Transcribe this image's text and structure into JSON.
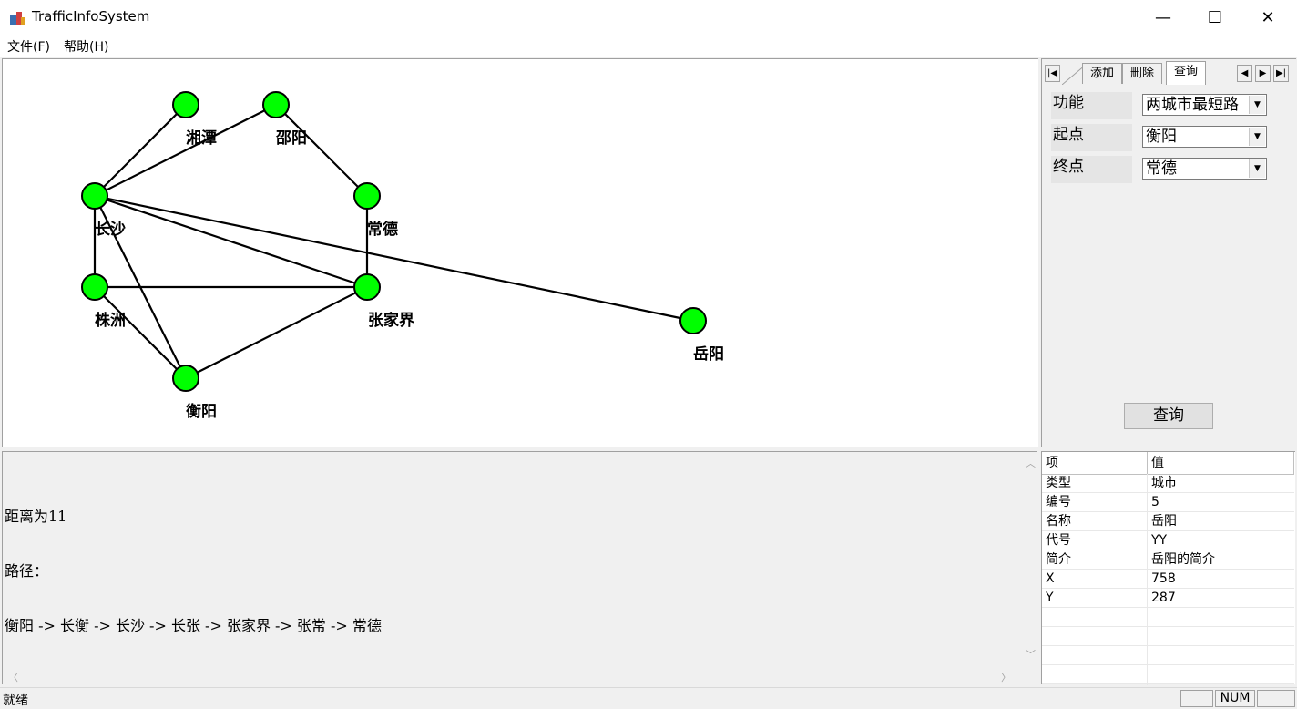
{
  "window": {
    "title": "TrafficInfoSystem",
    "minimize": "—",
    "maximize": "☐",
    "close": "✕"
  },
  "menu": {
    "items": [
      "文件(F)",
      "帮助(H)"
    ]
  },
  "tabs": [
    "添加",
    "删除",
    "查询"
  ],
  "query_form": {
    "function_label": "功能",
    "function_value": "两城市最短路",
    "start_label": "起点",
    "start_value": "衡阳",
    "end_label": "终点",
    "end_value": "常德",
    "button_label": "查询"
  },
  "graph": {
    "node_color": "#00ff00",
    "nodes": [
      {
        "name": "湘潭"
      },
      {
        "name": "邵阳"
      },
      {
        "name": "长沙"
      },
      {
        "name": "常德"
      },
      {
        "name": "株洲"
      },
      {
        "name": "张家界"
      },
      {
        "name": "岳阳"
      },
      {
        "name": "衡阳"
      }
    ]
  },
  "output": {
    "lines": [
      "距离为11",
      "路径：",
      "衡阳 -> 长衡 -> 长沙 -> 长张 -> 张家界 -> 张常 -> 常德"
    ]
  },
  "properties": {
    "headers": [
      "项",
      "值"
    ],
    "rows": [
      [
        "类型",
        "城市"
      ],
      [
        "编号",
        "5"
      ],
      [
        "名称",
        "岳阳"
      ],
      [
        "代号",
        "YY"
      ],
      [
        "简介",
        "岳阳的简介"
      ],
      [
        "X",
        "758"
      ],
      [
        "Y",
        "287"
      ]
    ]
  },
  "status": {
    "text": "就绪",
    "num": "NUM"
  }
}
